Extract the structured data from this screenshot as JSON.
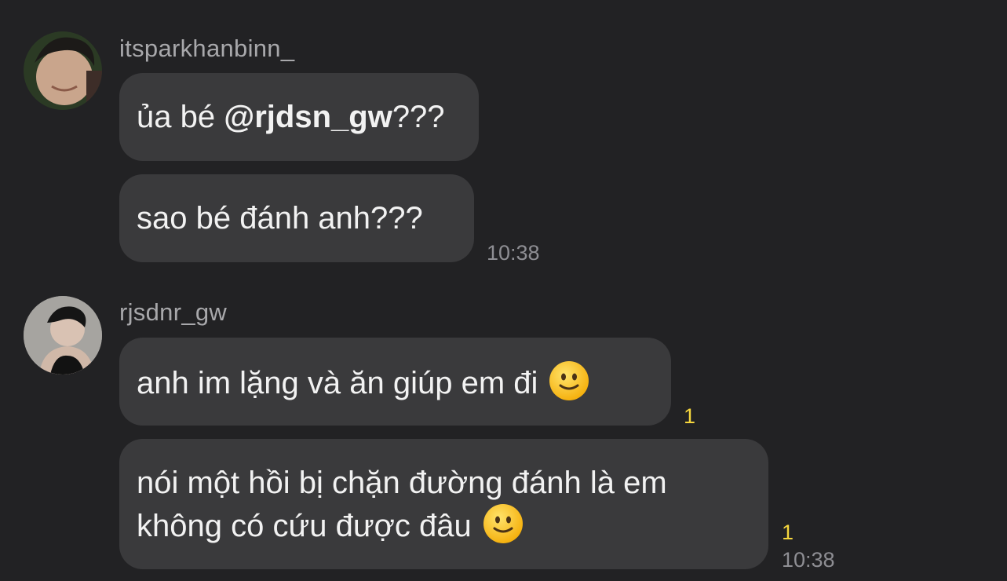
{
  "groups": [
    {
      "username": "itsparkhanbinn_",
      "messages": [
        {
          "prefix": "ủa bé ",
          "mention": "@rjdsn_gw",
          "suffix": "???"
        },
        {
          "text": "sao bé đánh anh???"
        }
      ],
      "time": "10:38"
    },
    {
      "username": "rjsdnr_gw",
      "messages": [
        {
          "text": "anh im lặng và ăn giúp em đi",
          "emoji": "slightly-smiling-face",
          "unread": "1"
        },
        {
          "line1": "nói một hồi bị chặn đường đánh là em",
          "line2": "không có cứu được đâu",
          "emoji": "slightly-smiling-face",
          "unread": "1"
        }
      ],
      "time": "10:38"
    }
  ]
}
